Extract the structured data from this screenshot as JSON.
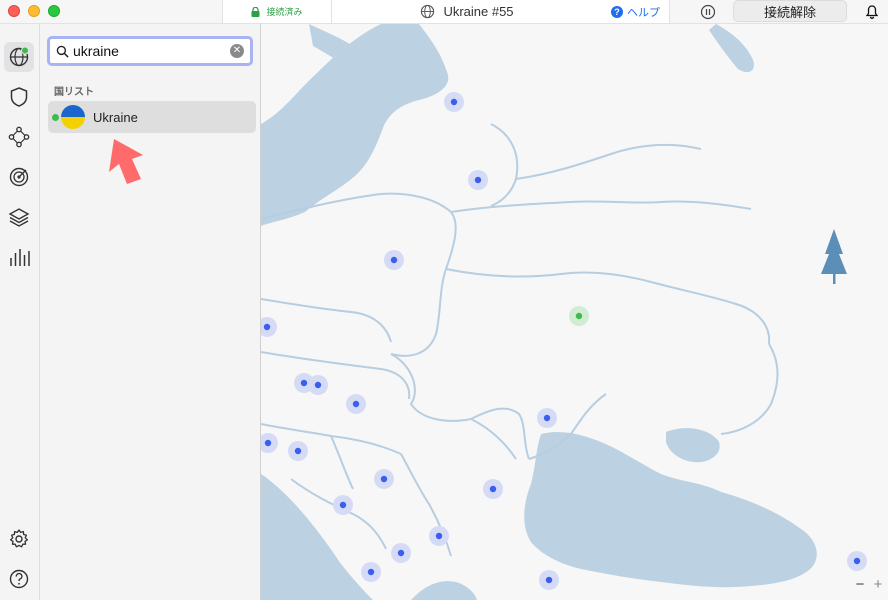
{
  "titlebar": {
    "status": "接続済み",
    "server": "Ukraine #55",
    "help": "ヘルプ",
    "disconnect": "接続解除"
  },
  "search": {
    "value": "ukraine"
  },
  "results": {
    "section_label": "国リスト",
    "items": [
      {
        "name": "Ukraine",
        "connected": true
      }
    ]
  },
  "map": {
    "zoom_in": "+",
    "zoom_out": "−"
  },
  "colors": {
    "accent": "#1f6feb",
    "connected": "#2ea043",
    "water": "#bcd2e2",
    "border": "#b7cde0"
  }
}
